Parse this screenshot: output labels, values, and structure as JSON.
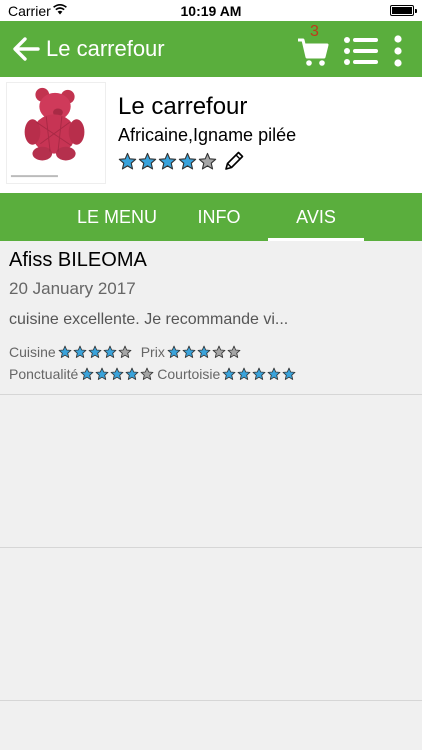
{
  "status_bar": {
    "carrier": "Carrier",
    "time": "10:19 AM"
  },
  "nav": {
    "title": "Le carrefour",
    "cart_count": "3"
  },
  "restaurant": {
    "name": "Le carrefour",
    "cuisine": "Africaine,Igname pilée",
    "rating": 4,
    "max_rating": 5
  },
  "tabs": [
    {
      "label": "LE MENU",
      "active": false
    },
    {
      "label": "INFO",
      "active": false
    },
    {
      "label": "AVIS",
      "active": true
    }
  ],
  "reviews": [
    {
      "author": "Afiss BILEOMA",
      "date": "20 January 2017",
      "text": "cuisine excellente.  Je recommande vi...",
      "ratings": [
        {
          "label": "Cuisine",
          "value": 4
        },
        {
          "label": "Prix",
          "value": 3
        },
        {
          "label": "Ponctualité",
          "value": 4
        },
        {
          "label": "Courtoisie",
          "value": 5
        }
      ]
    }
  ],
  "colors": {
    "brand_green": "#5aae3d",
    "star_filled": "#3aa3db",
    "star_empty": "#a6a6a6",
    "cart_count": "#c0391b"
  }
}
